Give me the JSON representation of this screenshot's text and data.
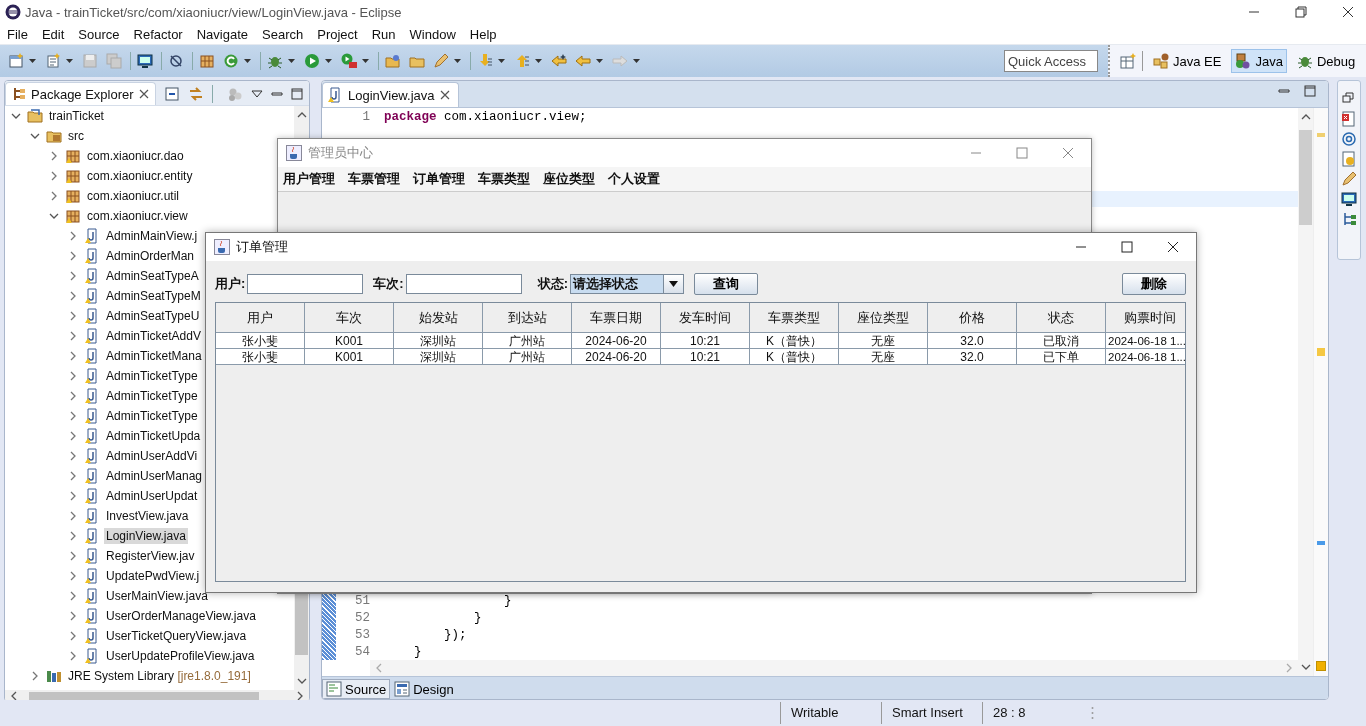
{
  "window": {
    "title": "Java - trainTicket/src/com/xiaoniucr/view/LoginView.java - Eclipse"
  },
  "menu": [
    "File",
    "Edit",
    "Source",
    "Refactor",
    "Navigate",
    "Search",
    "Project",
    "Run",
    "Window",
    "Help"
  ],
  "quick_access": {
    "placeholder": "Quick Access"
  },
  "perspectives": [
    {
      "label": "Java EE",
      "selected": false
    },
    {
      "label": "Java",
      "selected": true
    },
    {
      "label": "Debug",
      "selected": false
    }
  ],
  "package_explorer": {
    "title": "Package Explorer",
    "tree": [
      {
        "label": "trainTicket",
        "kind": "project",
        "expanded": true,
        "selected": false,
        "children": [
          {
            "label": "src",
            "kind": "source",
            "expanded": true,
            "selected": false,
            "children": [
              {
                "label": "com.xiaoniucr.dao",
                "kind": "package",
                "expanded": false,
                "selected": false
              },
              {
                "label": "com.xiaoniucr.entity",
                "kind": "package",
                "expanded": false,
                "selected": false
              },
              {
                "label": "com.xiaoniucr.util",
                "kind": "package",
                "expanded": false,
                "selected": false
              },
              {
                "label": "com.xiaoniucr.view",
                "kind": "package",
                "expanded": true,
                "selected": false,
                "children": [
                  {
                    "label": "AdminMainView.j",
                    "kind": "file",
                    "expanded": false,
                    "selected": false
                  },
                  {
                    "label": "AdminOrderMan",
                    "kind": "file",
                    "expanded": false,
                    "selected": false
                  },
                  {
                    "label": "AdminSeatTypeA",
                    "kind": "file",
                    "expanded": false,
                    "selected": false
                  },
                  {
                    "label": "AdminSeatTypeM",
                    "kind": "file",
                    "expanded": false,
                    "selected": false
                  },
                  {
                    "label": "AdminSeatTypeU",
                    "kind": "file",
                    "expanded": false,
                    "selected": false
                  },
                  {
                    "label": "AdminTicketAddV",
                    "kind": "file",
                    "expanded": false,
                    "selected": false
                  },
                  {
                    "label": "AdminTicketMana",
                    "kind": "file",
                    "expanded": false,
                    "selected": false
                  },
                  {
                    "label": "AdminTicketType",
                    "kind": "file",
                    "expanded": false,
                    "selected": false
                  },
                  {
                    "label": "AdminTicketType",
                    "kind": "file",
                    "expanded": false,
                    "selected": false
                  },
                  {
                    "label": "AdminTicketType",
                    "kind": "file",
                    "expanded": false,
                    "selected": false
                  },
                  {
                    "label": "AdminTicketUpda",
                    "kind": "file",
                    "expanded": false,
                    "selected": false
                  },
                  {
                    "label": "AdminUserAddVi",
                    "kind": "file",
                    "expanded": false,
                    "selected": false
                  },
                  {
                    "label": "AdminUserManag",
                    "kind": "file",
                    "expanded": false,
                    "selected": false
                  },
                  {
                    "label": "AdminUserUpdat",
                    "kind": "file",
                    "expanded": false,
                    "selected": false
                  },
                  {
                    "label": "InvestView.java",
                    "kind": "file",
                    "expanded": false,
                    "selected": false
                  },
                  {
                    "label": "LoginView.java",
                    "kind": "file",
                    "expanded": false,
                    "selected": true
                  },
                  {
                    "label": "RegisterView.jav",
                    "kind": "file",
                    "expanded": false,
                    "selected": false
                  },
                  {
                    "label": "UpdatePwdView.j",
                    "kind": "file",
                    "expanded": false,
                    "selected": false
                  },
                  {
                    "label": "UserMainView.java",
                    "kind": "file",
                    "expanded": false,
                    "selected": false
                  },
                  {
                    "label": "UserOrderManageView.java",
                    "kind": "file",
                    "expanded": false,
                    "selected": false
                  },
                  {
                    "label": "UserTicketQueryView.java",
                    "kind": "file",
                    "expanded": false,
                    "selected": false
                  },
                  {
                    "label": "UserUpdateProfileView.java",
                    "kind": "file",
                    "expanded": false,
                    "selected": false
                  }
                ]
              }
            ]
          },
          {
            "label": "JRE System Library",
            "decoration": "[jre1.8.0_191]",
            "kind": "library",
            "expanded": false,
            "selected": false
          }
        ]
      }
    ]
  },
  "editor": {
    "tab": "LoginView.java",
    "top_lines": [
      {
        "number": "1",
        "code": "**package** com.xiaoniucr.view;"
      }
    ],
    "bottom_lines": [
      {
        "number": "51",
        "code": "                }"
      },
      {
        "number": "52",
        "code": "            }"
      },
      {
        "number": "53",
        "code": "        });"
      },
      {
        "number": "54",
        "code": "    }"
      }
    ],
    "bottom_tabs": [
      {
        "label": "Source",
        "selected": true
      },
      {
        "label": "Design",
        "selected": false
      }
    ]
  },
  "admin_window": {
    "title": "管理员中心",
    "menu": [
      "用户管理",
      "车票管理",
      "订单管理",
      "车票类型",
      "座位类型",
      "个人设置"
    ]
  },
  "order_window": {
    "title": "订单管理",
    "filters": [
      {
        "label": "用户:",
        "kind": "text"
      },
      {
        "label": "车次:",
        "kind": "text"
      },
      {
        "label": "状态:",
        "kind": "select",
        "value": "请选择状态"
      }
    ],
    "query_button": "查询",
    "delete_button": "删除",
    "table": {
      "columns": [
        "用户",
        "车次",
        "始发站",
        "到达站",
        "车票日期",
        "发车时间",
        "车票类型",
        "座位类型",
        "价格",
        "状态",
        "购票时间"
      ],
      "rows": [
        [
          "张小斐",
          "K001",
          "深圳站",
          "广州站",
          "2024-06-20",
          "10:21",
          "K（普快）",
          "无座",
          "32.0",
          "已取消",
          "2024-06-18 1..."
        ],
        [
          "张小斐",
          "K001",
          "深圳站",
          "广州站",
          "2024-06-20",
          "10:21",
          "K（普快）",
          "无座",
          "32.0",
          "已下单",
          "2024-06-18 1..."
        ]
      ]
    }
  },
  "status_bar": [
    "Writable",
    "Smart Insert",
    "28 : 8"
  ]
}
